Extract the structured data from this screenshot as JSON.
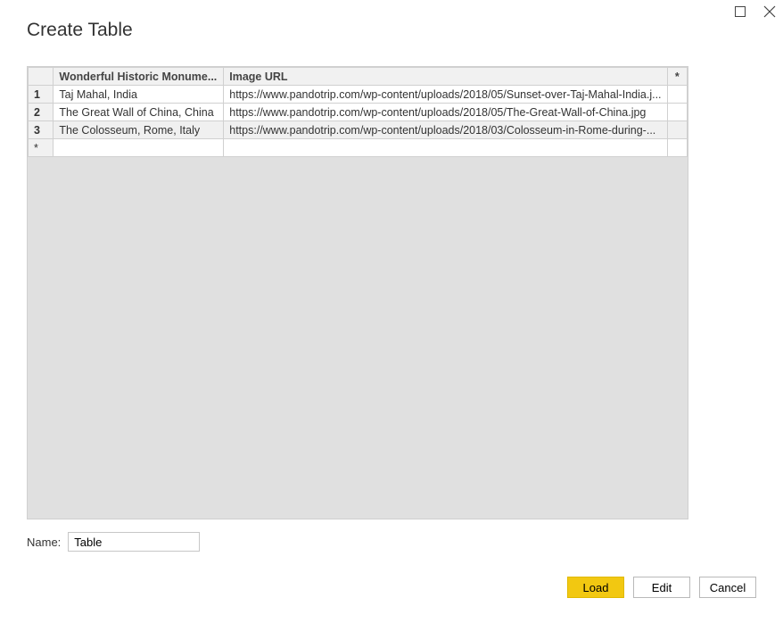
{
  "dialog": {
    "title": "Create Table",
    "columns": [
      {
        "label": "Wonderful Historic Monume..."
      },
      {
        "label": "Image URL"
      }
    ],
    "star_header": "*",
    "rows": [
      {
        "n": "1",
        "c1": "Taj Mahal, India",
        "c2": "https://www.pandotrip.com/wp-content/uploads/2018/05/Sunset-over-Taj-Mahal-India.j...",
        "selected": false
      },
      {
        "n": "2",
        "c1": "The Great Wall of China, China",
        "c2": "https://www.pandotrip.com/wp-content/uploads/2018/05/The-Great-Wall-of-China.jpg",
        "selected": false
      },
      {
        "n": "3",
        "c1": " The Colosseum, Rome, Italy",
        "c2": "https://www.pandotrip.com/wp-content/uploads/2018/03/Colosseum-in-Rome-during-...",
        "selected": true
      }
    ],
    "newrow_marker": "*",
    "name_label": "Name:",
    "name_value": "Table",
    "buttons": {
      "load": "Load",
      "edit": "Edit",
      "cancel": "Cancel"
    }
  }
}
